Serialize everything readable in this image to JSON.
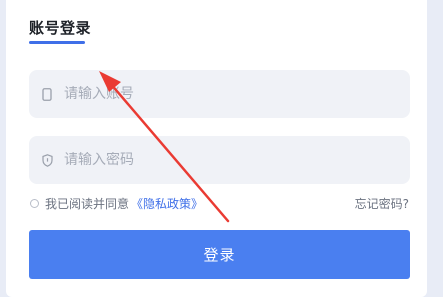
{
  "login_form": {
    "tab_label": "账号登录",
    "account": {
      "value": "",
      "placeholder": "请输入账号",
      "icon": "phone-icon"
    },
    "password": {
      "value": "",
      "placeholder": "请输入密码",
      "icon": "shield-icon"
    },
    "agreement": {
      "prefix": "我已阅读并同意",
      "policy_link": "《隐私政策》",
      "checked": false
    },
    "forgot_label": "忘记密码?",
    "submit_label": "登录"
  },
  "annotation": {
    "icon": "red-arrow-icon",
    "color": "#ea3b33"
  },
  "colors": {
    "accent": "#4a7ff0",
    "link": "#3f6fe8",
    "field_bg": "#f0f2f7",
    "page_bg": "#e8ecf6"
  }
}
